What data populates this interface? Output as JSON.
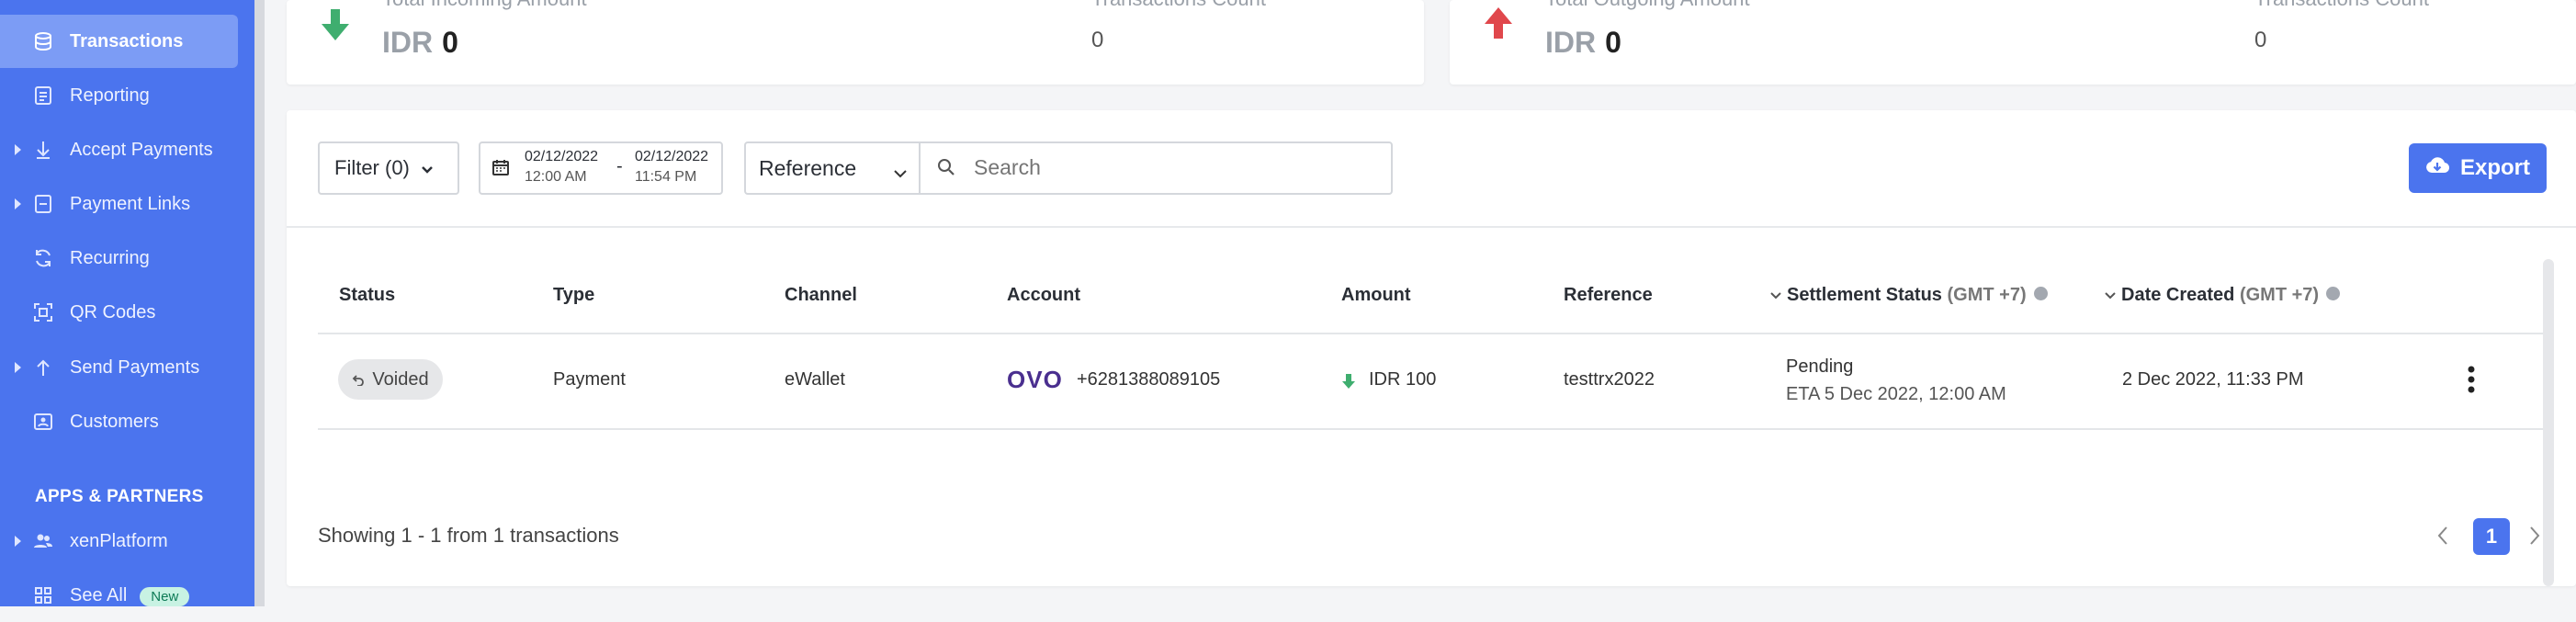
{
  "sidebar": {
    "items": [
      {
        "label": "Transactions"
      },
      {
        "label": "Reporting"
      },
      {
        "label": "Accept Payments"
      },
      {
        "label": "Payment Links"
      },
      {
        "label": "Recurring"
      },
      {
        "label": "QR Codes"
      },
      {
        "label": "Send Payments"
      },
      {
        "label": "Customers"
      }
    ],
    "section_title": "APPS & PARTNERS",
    "partner_items": [
      {
        "label": "xenPlatform"
      },
      {
        "label": "See All",
        "badge": "New"
      }
    ]
  },
  "incoming": {
    "label": "Total Incoming Amount",
    "currency": "IDR",
    "amount": "0",
    "count_label": "Transactions Count",
    "count": "0"
  },
  "outgoing": {
    "label": "Total Outgoing Amount",
    "currency": "IDR",
    "amount": "0",
    "count_label": "Transactions Count",
    "count": "0"
  },
  "toolbar": {
    "filter_label": "Filter (0)",
    "date_from": "02/12/2022",
    "time_from": "12:00 AM",
    "date_sep": "-",
    "date_to": "02/12/2022",
    "time_to": "11:54 PM",
    "search_type": "Reference",
    "search_placeholder": "Search",
    "export_label": "Export"
  },
  "table": {
    "headers": {
      "status": "Status",
      "type": "Type",
      "channel": "Channel",
      "account": "Account",
      "amount": "Amount",
      "reference": "Reference",
      "settlement": "Settlement Status",
      "settlement_tz": "(GMT +7)",
      "date": "Date Created",
      "date_tz": "(GMT +7)"
    },
    "rows": [
      {
        "status": "Voided",
        "type": "Payment",
        "channel": "eWallet",
        "account_logo": "OVO",
        "account": "+6281388089105",
        "amount": "IDR 100",
        "reference": "testtrx2022",
        "settlement": "Pending",
        "settlement_eta": "ETA 5 Dec 2022, 12:00 AM",
        "date": "2 Dec 2022, 11:33 PM"
      }
    ]
  },
  "pagination": {
    "summary": "Showing 1 - 1 from 1 transactions",
    "current_page": "1"
  },
  "colors": {
    "primary": "#4b74ee",
    "incoming": "#3fae6f",
    "outgoing": "#e0474c",
    "ovo": "#4a2f8f"
  }
}
